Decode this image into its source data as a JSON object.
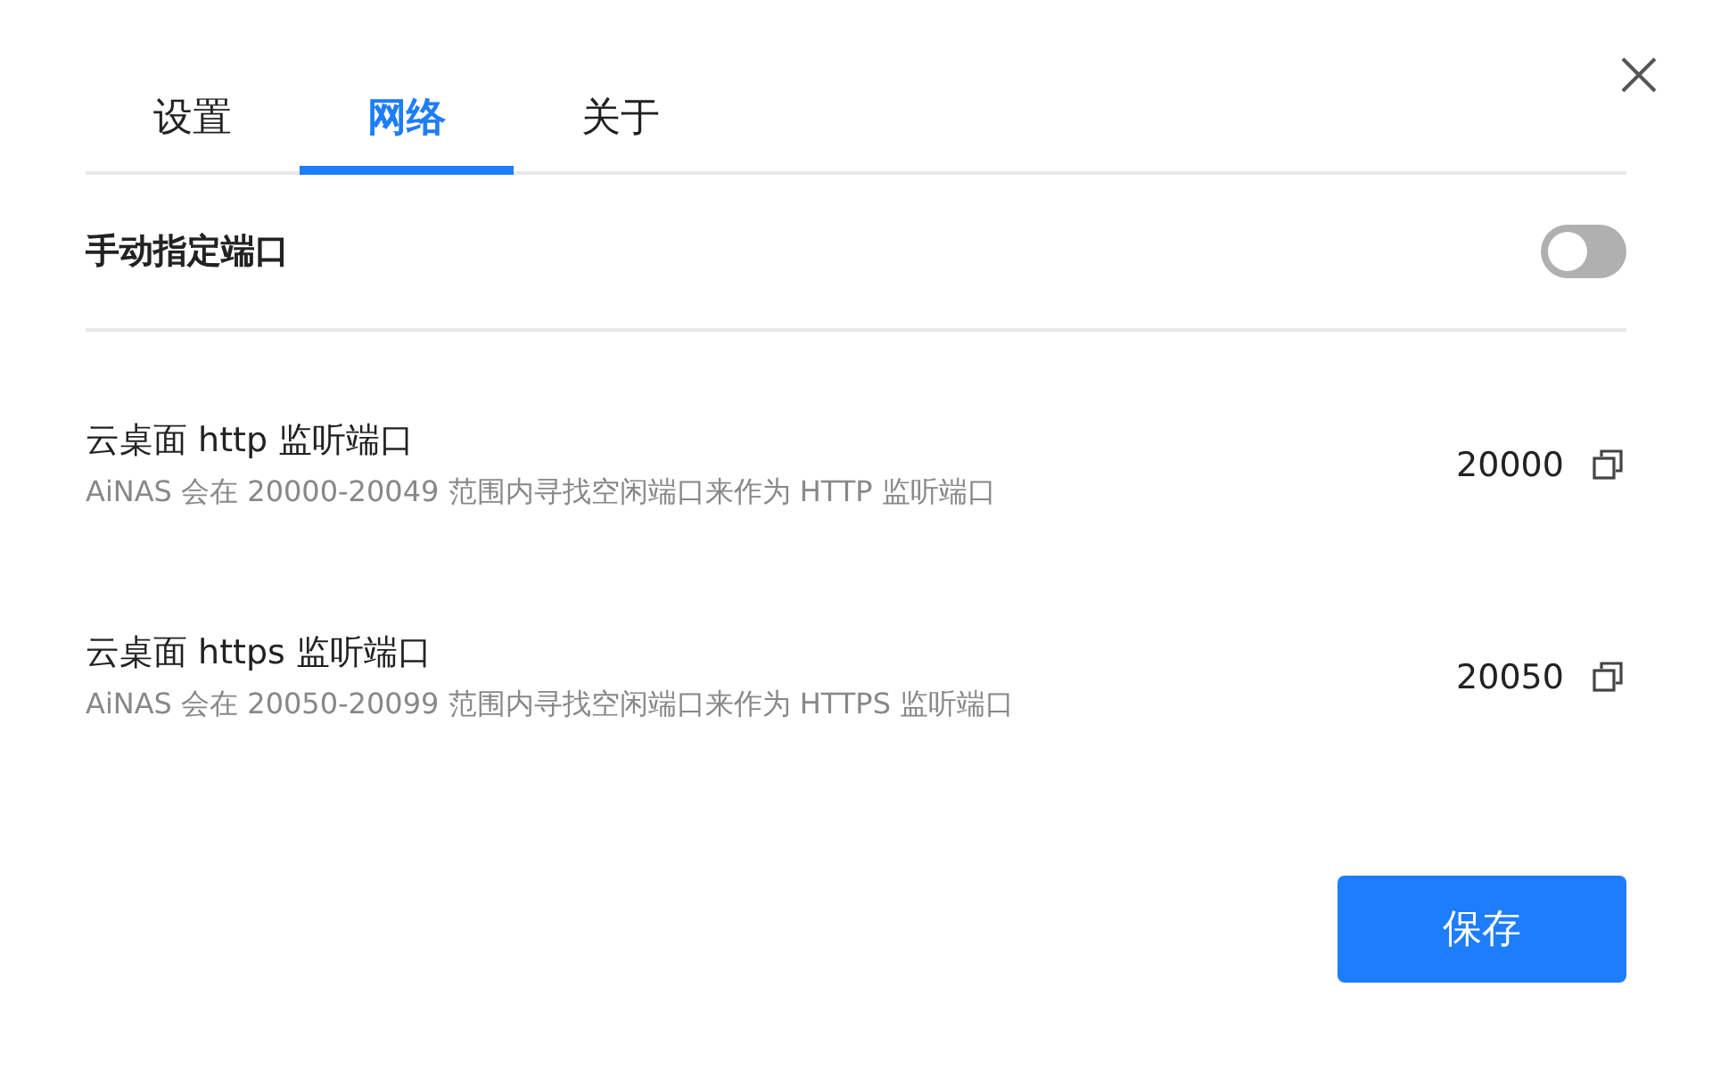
{
  "tabs": [
    {
      "label": "设置",
      "selected": false
    },
    {
      "label": "网络",
      "selected": true
    },
    {
      "label": "关于",
      "selected": false
    }
  ],
  "manual_port": {
    "label": "手动指定端口",
    "on": false
  },
  "ports": [
    {
      "title": "云桌面 http 监听端口",
      "description": "AiNAS 会在 20000-20049 范围内寻找空闲端口来作为 HTTP 监听端口",
      "value": "20000"
    },
    {
      "title": "云桌面 https 监听端口",
      "description": "AiNAS 会在 20050-20099 范围内寻找空闲端口来作为 HTTPS 监听端口",
      "value": "20050"
    }
  ],
  "save_button": "保存"
}
